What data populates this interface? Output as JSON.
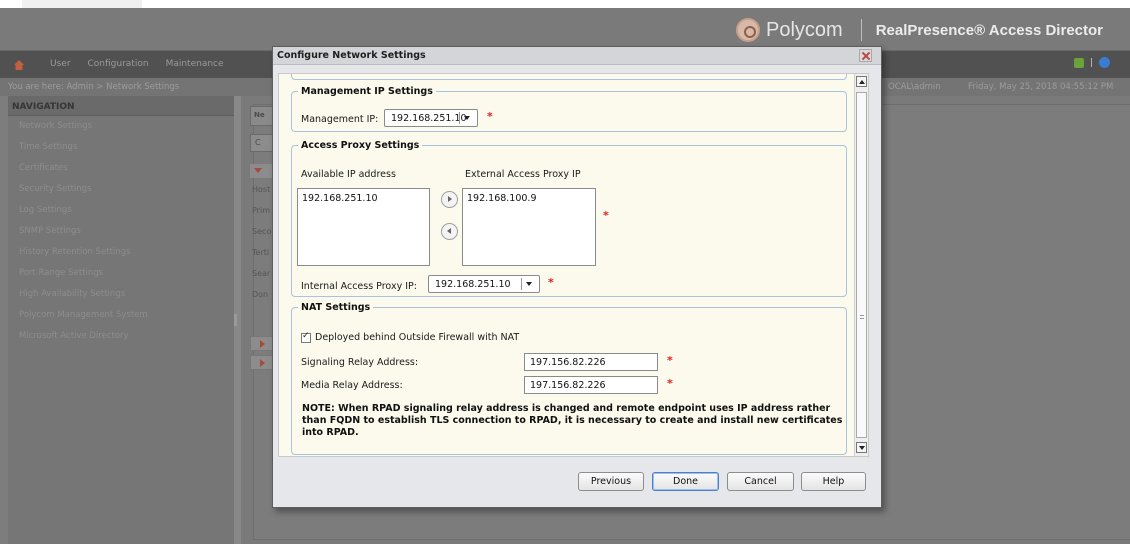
{
  "header": {
    "brand": "Polycom",
    "product": "RealPresence® Access Director"
  },
  "menubar": {
    "items": [
      "User",
      "Configuration",
      "Maintenance"
    ]
  },
  "breadcrumb": {
    "text": "You are here:  Admin  >  Network Settings",
    "user": "OCAL\\admin",
    "datetime": "Friday, May 25, 2018 04:55:12 PM"
  },
  "nav": {
    "title": "NAVIGATION",
    "items": [
      "Network Settings",
      "Time Settings",
      "Certificates",
      "Security Settings",
      "Log Settings",
      "SNMP Settings",
      "History Retention Settings",
      "Port Range Settings",
      "High Availability Settings",
      "Polycom Management System",
      "Microsoft Active Directory"
    ]
  },
  "background": {
    "tab": "Ne",
    "button": "C",
    "labels": [
      "Host",
      "Prim",
      "Seco",
      "Terti",
      "Sear",
      "Don"
    ]
  },
  "dialog": {
    "title": "Configure Network Settings",
    "management": {
      "legend": "Management IP Settings",
      "label": "Management IP:",
      "value": "192.168.251.10"
    },
    "access_proxy": {
      "legend": "Access Proxy Settings",
      "available_label": "Available IP address",
      "external_label": "External Access Proxy IP",
      "available_items": [
        "192.168.251.10"
      ],
      "external_items": [
        "192.168.100.9"
      ],
      "internal_label": "Internal Access Proxy IP:",
      "internal_value": "192.168.251.10"
    },
    "nat": {
      "legend": "NAT Settings",
      "checkbox_label": "Deployed behind Outside Firewall with NAT",
      "checked": true,
      "signaling_label": "Signaling Relay Address:",
      "signaling_value": "197.156.82.226",
      "media_label": "Media Relay Address:",
      "media_value": "197.156.82.226",
      "note": "NOTE: When RPAD signaling relay address is changed and remote endpoint uses IP address rather than FQDN to establish TLS connection to RPAD, it is necessary to create and install new certificates into RPAD."
    },
    "required_marker": "*",
    "buttons": {
      "previous": "Previous",
      "done": "Done",
      "cancel": "Cancel",
      "help": "Help"
    }
  },
  "colors": {
    "required": "#e02020",
    "panel_bg": "#fbfaec",
    "fieldset_border": "#a9c2dd",
    "primary_button_border": "#4a7ec7"
  }
}
